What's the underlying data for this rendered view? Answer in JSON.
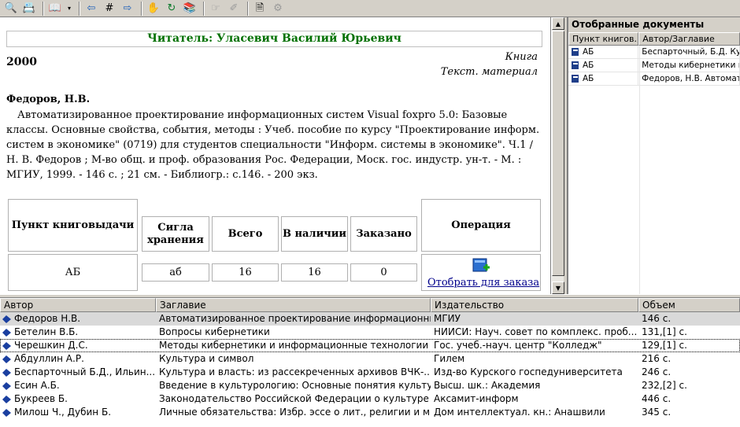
{
  "reader": {
    "label": "Читатель: Уласевич Василий Юрьевич"
  },
  "record": {
    "year": "2000",
    "type_line1": "Книга",
    "type_line2": "Текст. материал",
    "author": "Федоров, Н.В.",
    "description": "Автоматизированное проектирование информационных систем Visual foxpro 5.0: Базовые классы. Основные свойства, события, методы : Учеб. пособие по курсу \"Проектирование информ. систем в экономике\" (0719) для студентов специальности \"Информ. системы в экономике\". Ч.1 / Н. В. Федоров ; М-во общ. и проф. образования Рос. Федерации, Моск. гос. индустр. ун-т. - М. : МГИУ, 1999. - 146 с. ; 21 см. - Библиогр.: с.146. - 200 экз."
  },
  "holdings": {
    "headers": {
      "point": "Пункт книговыдачи",
      "sigla": "Сигла хранения",
      "total": "Всего",
      "available": "В наличии",
      "ordered": "Заказано",
      "operation": "Операция"
    },
    "row": {
      "point": "АБ",
      "sigla": "аб",
      "total": "16",
      "available": "16",
      "ordered": "0"
    },
    "order_link": "Отобрать для заказа"
  },
  "selected_docs": {
    "title": "Отобранные документы",
    "columns": [
      "Пункт книгов...",
      "Автор/Заглавие"
    ],
    "rows": [
      {
        "point": "АБ",
        "author_title": "Беспарточный, Б.Д.   Культура"
      },
      {
        "point": "АБ",
        "author_title": "Методы кибернетики и инф"
      },
      {
        "point": "АБ",
        "author_title": "Федоров, Н.В.   Автоматиз"
      }
    ]
  },
  "results": {
    "columns": [
      "Автор",
      "Заглавие",
      "Издательство",
      "Объем"
    ],
    "rows": [
      {
        "author": "Федоров Н.В.",
        "title": "Автоматизированное проектирование информационны...",
        "publisher": "МГИУ",
        "volume": "146 с."
      },
      {
        "author": "Бетелин В.Б.",
        "title": "Вопросы кибернетики",
        "publisher": "НИИСИ: Науч. совет по комплекс. проб...",
        "volume": "131,[1] с."
      },
      {
        "author": "Черешкин Д.С.",
        "title": "Методы кибернетики и информационные технологии",
        "publisher": "Гос. учеб.-науч. центр \"Колледж\"",
        "volume": "129,[1] с."
      },
      {
        "author": "Абдуллин А.Р.",
        "title": "Культура и символ",
        "publisher": "Гилем",
        "volume": "216 с."
      },
      {
        "author": "Беспарточный Б.Д., Ильин...",
        "title": "Культура и власть: из рассекреченных архивов ВЧК-...",
        "publisher": "Изд-во Курского госпедуниверситета",
        "volume": "246 с."
      },
      {
        "author": "Есин А.Б.",
        "title": "Введение в культурологию: Основные понятия культу...",
        "publisher": "Высш. шк.: Академия",
        "volume": "232,[2] с."
      },
      {
        "author": "Букреев Б.",
        "title": "Законодательство Российской Федерации о культуре",
        "publisher": "Аксамит-информ",
        "volume": "446 с."
      },
      {
        "author": "Милош Ч., Дубин Б.",
        "title": "Личные обязательства: Избр. эссе о лит., религии и м...",
        "publisher": "Дом интеллектуал. кн.: Анашвили",
        "volume": "345 с."
      }
    ]
  }
}
